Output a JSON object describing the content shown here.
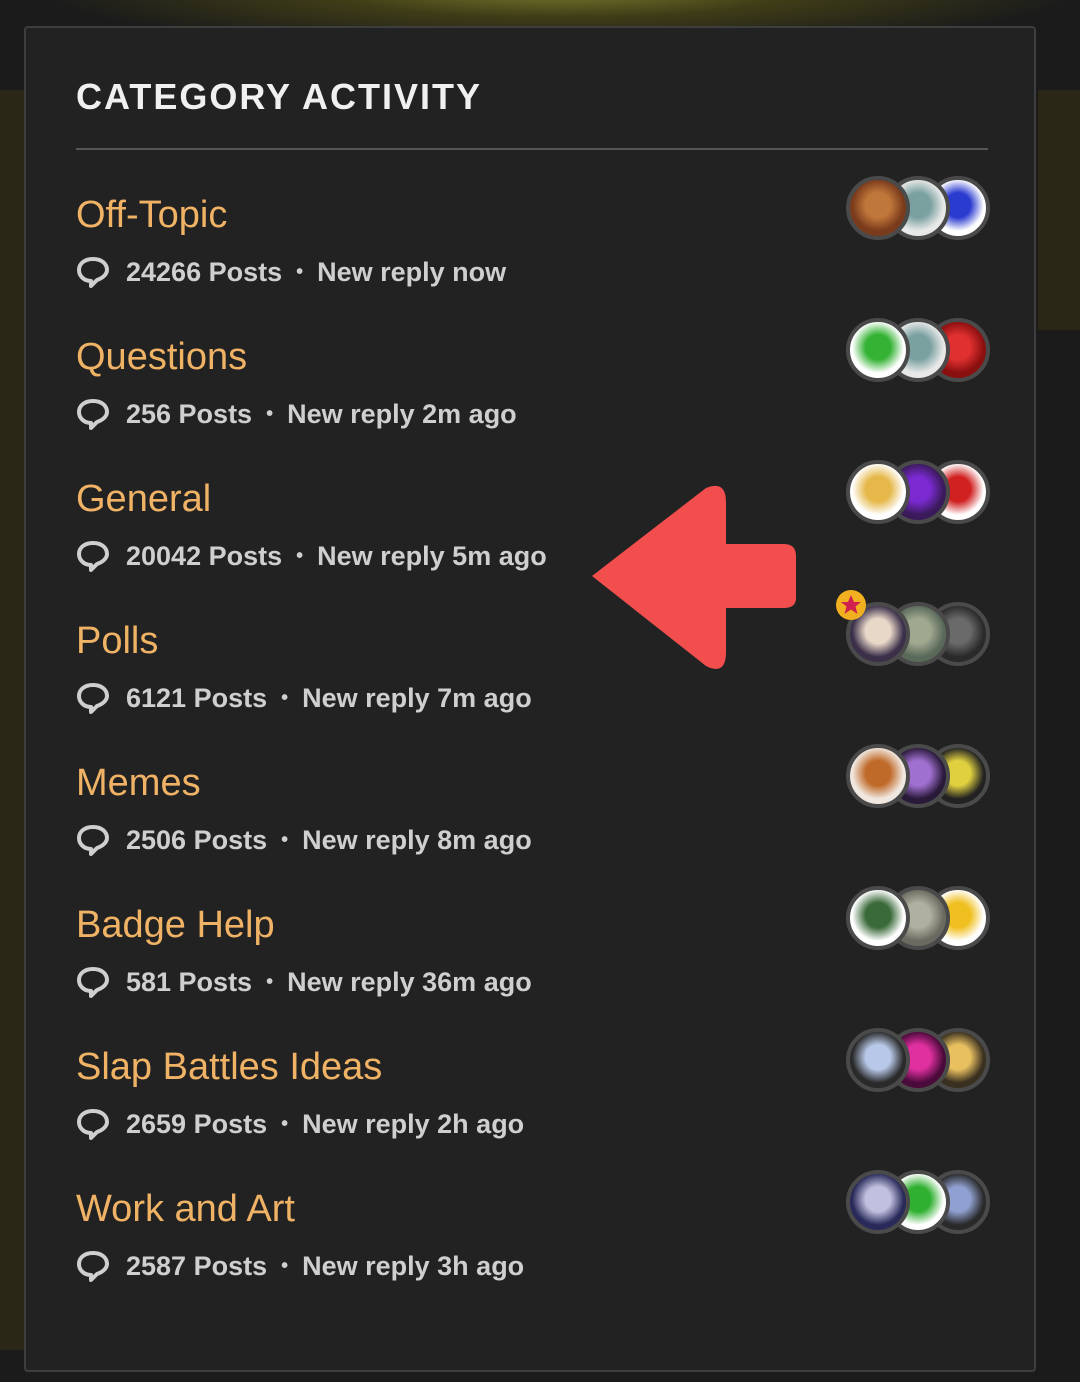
{
  "panel": {
    "title": "CATEGORY ACTIVITY"
  },
  "categories": [
    {
      "name": "Off-Topic",
      "posts": "24266 Posts",
      "last": "New reply now",
      "avatars": [
        [
          "#7a3b1c",
          "#c0773a"
        ],
        [
          "#e8e8e8",
          "#7aa0a0"
        ],
        [
          "#ffffff",
          "#2a3bd0"
        ]
      ]
    },
    {
      "name": "Questions",
      "posts": "256 Posts",
      "last": "New reply 2m ago",
      "avatars": [
        [
          "#ffffff",
          "#33b233"
        ],
        [
          "#e8e8e8",
          "#7aa0a0"
        ],
        [
          "#8a0f0f",
          "#e03030"
        ]
      ]
    },
    {
      "name": "General",
      "posts": "20042 Posts",
      "last": "New reply 5m ago",
      "avatars": [
        [
          "#ffffff",
          "#e6b84a"
        ],
        [
          "#3a1a5a",
          "#7a2ad0"
        ],
        [
          "#ffffff",
          "#d02020"
        ]
      ]
    },
    {
      "name": "Polls",
      "posts": "6121 Posts",
      "last": "New reply 7m ago",
      "avatars": [
        [
          "#3b2f4a",
          "#e8d8c8"
        ],
        [
          "#5a6a5a",
          "#a0a890"
        ],
        [
          "#2a2a2a",
          "#6a6a6a"
        ]
      ]
    },
    {
      "name": "Memes",
      "posts": "2506 Posts",
      "last": "New reply 8m ago",
      "avatars": [
        [
          "#f0e8e0",
          "#c06a2a"
        ],
        [
          "#2a1a3a",
          "#a070d0"
        ],
        [
          "#222222",
          "#e0d040"
        ]
      ]
    },
    {
      "name": "Badge Help",
      "posts": "581 Posts",
      "last": "New reply 36m ago",
      "avatars": [
        [
          "#ffffff",
          "#3a6a3a"
        ],
        [
          "#6a6a60",
          "#b0b0a0"
        ],
        [
          "#ffffff",
          "#f0c020"
        ]
      ]
    },
    {
      "name": "Slap Battles Ideas",
      "posts": "2659 Posts",
      "last": "New reply 2h ago",
      "avatars": [
        [
          "#2a2a2a",
          "#b8c8e8"
        ],
        [
          "#4a0a3a",
          "#e030a0"
        ],
        [
          "#3a3020",
          "#e8c060"
        ]
      ]
    },
    {
      "name": "Work and Art",
      "posts": "2587 Posts",
      "last": "New reply 3h ago",
      "avatars": [
        [
          "#2a2a5a",
          "#c0c0e0"
        ],
        [
          "#ffffff",
          "#30b030"
        ],
        [
          "#2a2a2a",
          "#90a0d0"
        ]
      ]
    }
  ],
  "colors": {
    "accent": "#f0b366",
    "arrow": "#f24e4e",
    "panel": "#222222",
    "text": "#cfcfcf"
  },
  "icons": {
    "posts": "speech-bubble-icon",
    "pointer": "left-arrow-annotation"
  }
}
